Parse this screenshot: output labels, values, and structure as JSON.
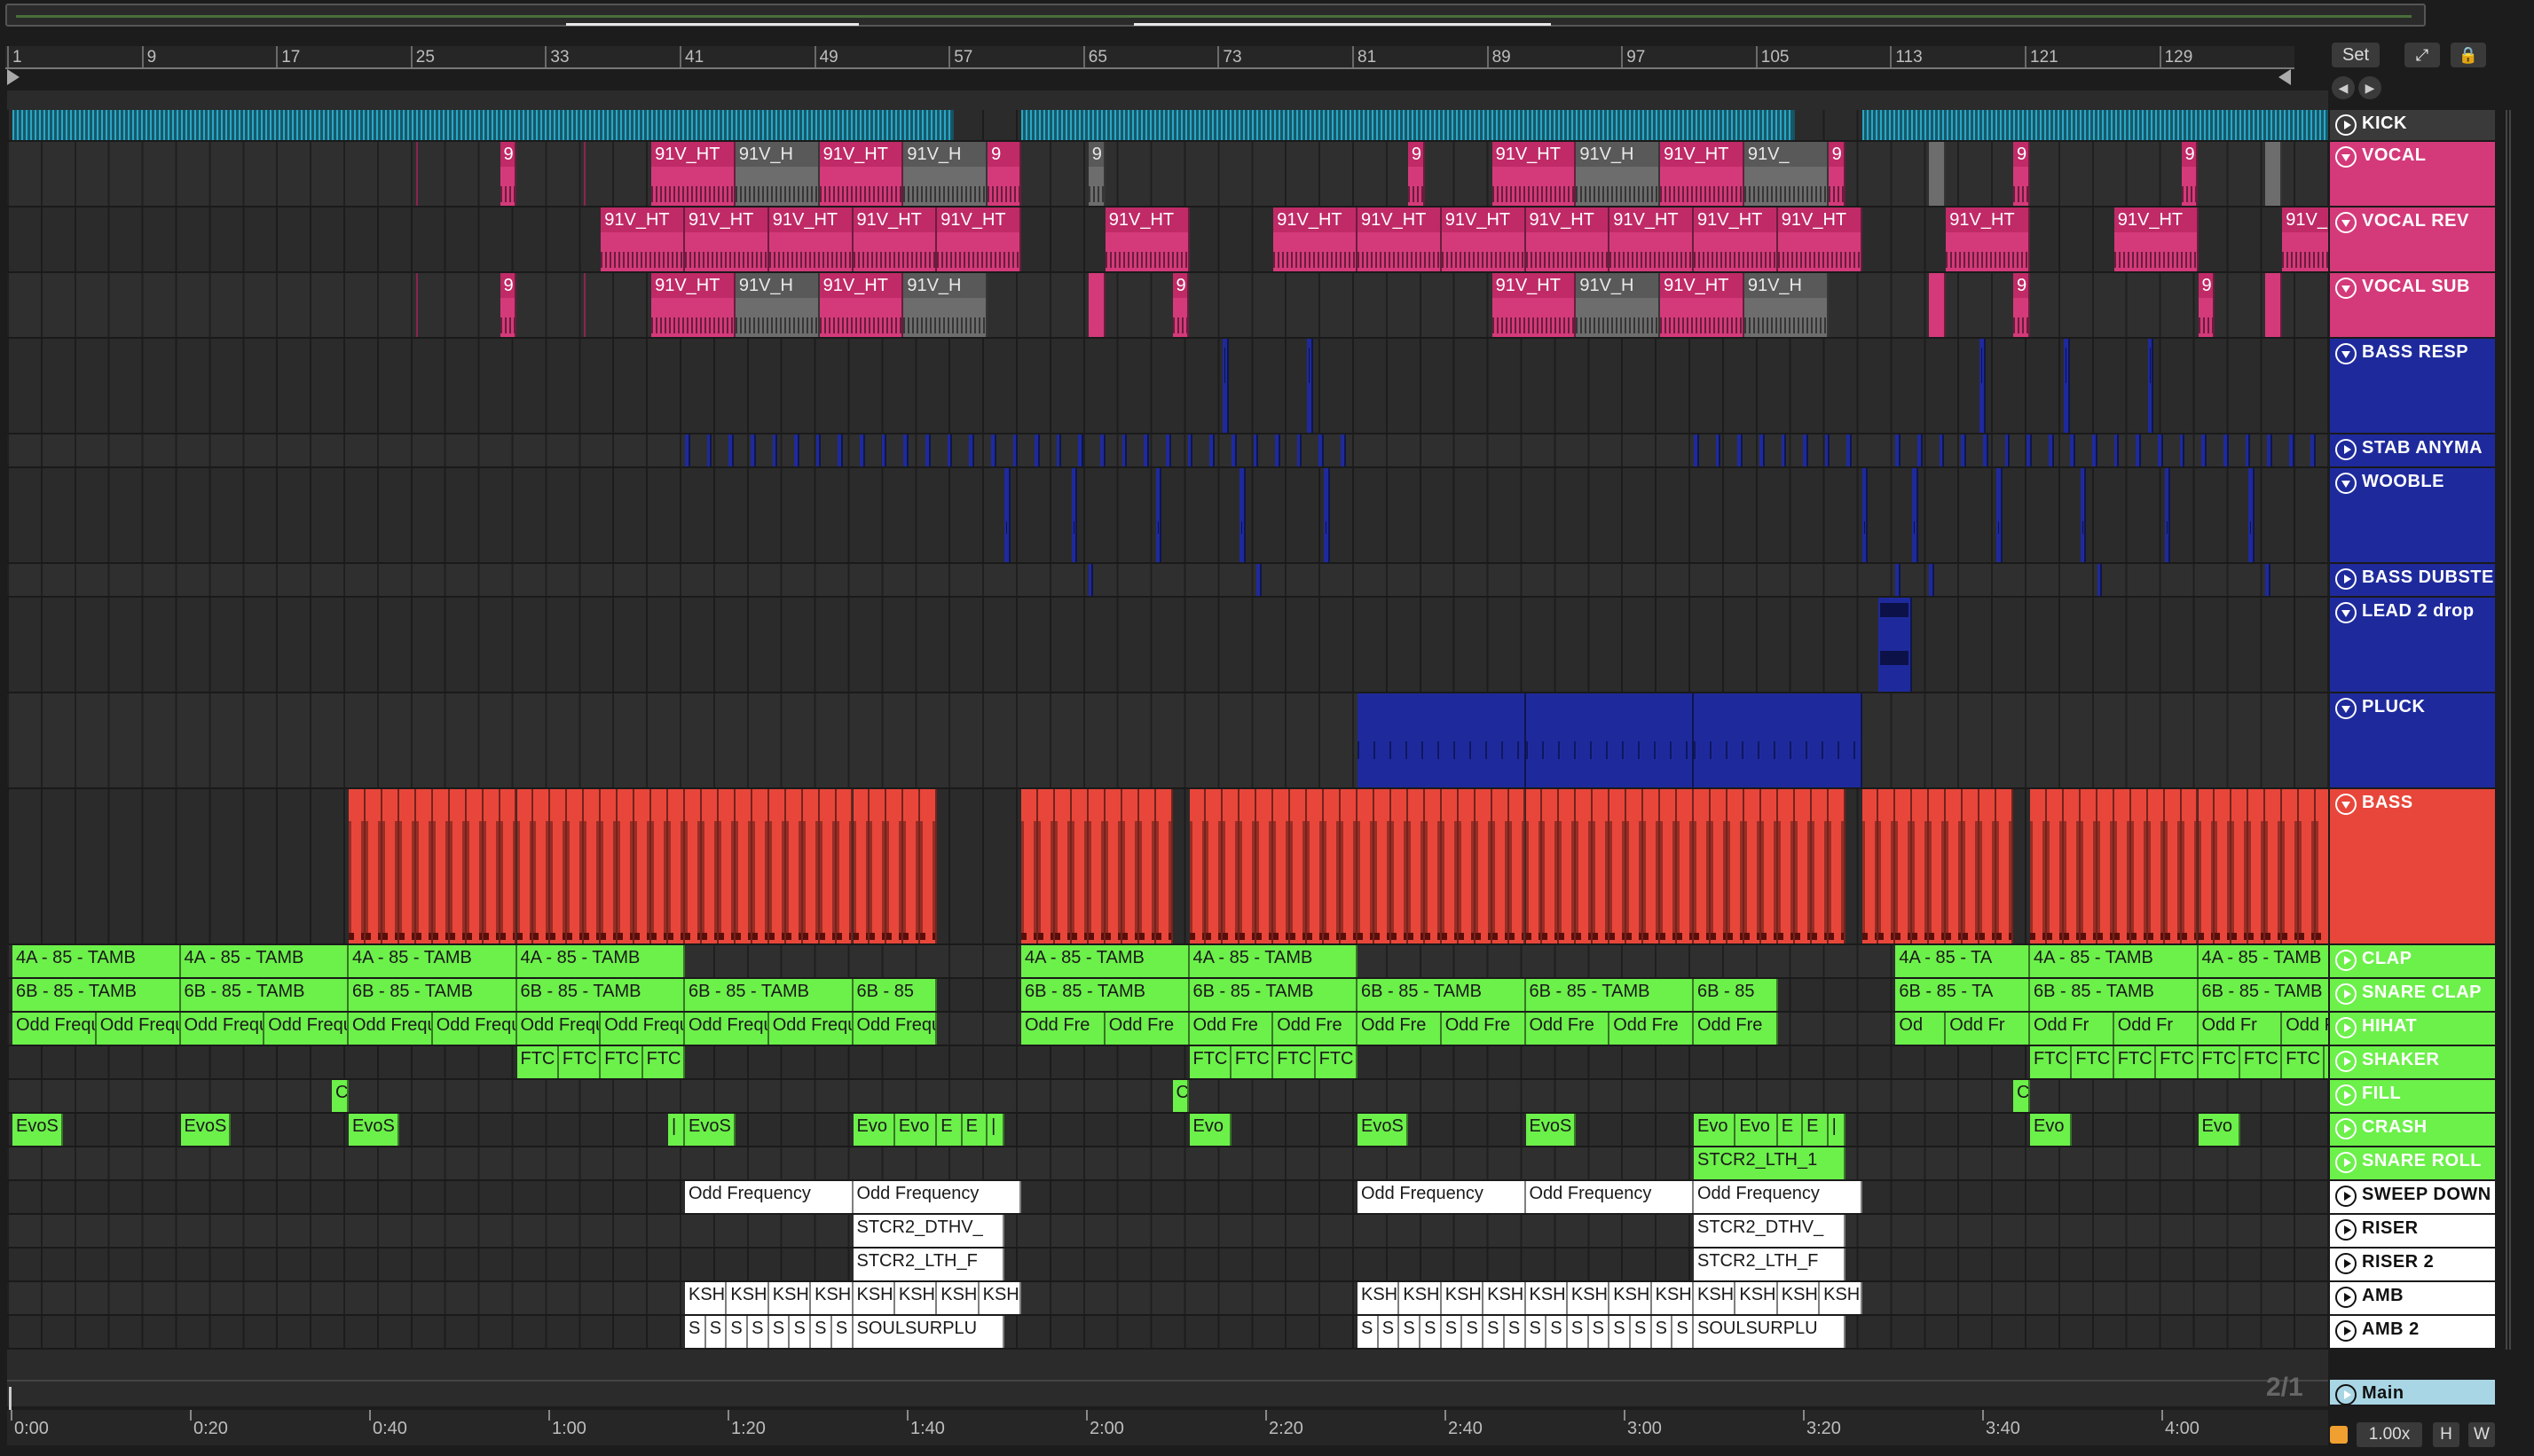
{
  "bar_numbers": [
    "1",
    "9",
    "17",
    "25",
    "33",
    "41",
    "49",
    "57",
    "65",
    "73",
    "81",
    "89",
    "97",
    "105",
    "113",
    "121",
    "129"
  ],
  "time_labels": [
    "0:00",
    "0:20",
    "0:40",
    "1:00",
    "1:20",
    "1:40",
    "2:00",
    "2:20",
    "2:40",
    "3:00",
    "3:20",
    "3:40",
    "4:00"
  ],
  "controls": {
    "set_label": "Set",
    "expand_icon": "⤢",
    "lock_icon": "🔒",
    "prev_icon": "◀",
    "next_icon": "▶"
  },
  "page_indicator": "2/1",
  "zoom": {
    "value": "1.00x",
    "h_label": "H",
    "w_label": "W"
  },
  "colors": {
    "pink": "#d43a7a",
    "navy": "#1e2a9c",
    "red": "#e8463a",
    "green": "#6cf04a",
    "white": "#ffffff",
    "main": "#a9d6e5"
  },
  "tracks": [
    {
      "name": "KICK",
      "color": "#3a3a3a",
      "icon": "play-icon"
    },
    {
      "name": "VOCAL",
      "color": "#d43a7a",
      "icon": "fold-icon"
    },
    {
      "name": "VOCAL REV",
      "color": "#d43a7a",
      "icon": "fold-icon"
    },
    {
      "name": "VOCAL SUB",
      "color": "#d43a7a",
      "icon": "fold-icon"
    },
    {
      "name": "BASS RESP",
      "color": "#1e2a9c",
      "icon": "fold-icon"
    },
    {
      "name": "STAB ANYMA",
      "color": "#1e2a9c",
      "icon": "play-icon"
    },
    {
      "name": "WOOBLE",
      "color": "#1e2a9c",
      "icon": "fold-icon"
    },
    {
      "name": "BASS DUBSTE",
      "color": "#1e2a9c",
      "icon": "play-icon"
    },
    {
      "name": "LEAD 2 drop",
      "color": "#1e2a9c",
      "icon": "fold-icon"
    },
    {
      "name": "PLUCK",
      "color": "#1e2a9c",
      "icon": "fold-icon"
    },
    {
      "name": "BASS",
      "color": "#e8463a",
      "icon": "fold-icon"
    },
    {
      "name": "CLAP",
      "color": "#6cf04a",
      "icon": "play-icon"
    },
    {
      "name": "SNARE CLAP",
      "color": "#6cf04a",
      "icon": "play-icon"
    },
    {
      "name": "HIHAT",
      "color": "#6cf04a",
      "icon": "play-icon"
    },
    {
      "name": "SHAKER",
      "color": "#6cf04a",
      "icon": "play-icon"
    },
    {
      "name": "FILL",
      "color": "#6cf04a",
      "icon": "play-icon"
    },
    {
      "name": "CRASH",
      "color": "#6cf04a",
      "icon": "play-icon"
    },
    {
      "name": "SNARE ROLL",
      "color": "#6cf04a",
      "icon": "play-icon"
    },
    {
      "name": "SWEEP DOWN",
      "color": "#ffffff",
      "icon": "play-icon"
    },
    {
      "name": "RISER",
      "color": "#ffffff",
      "icon": "play-icon"
    },
    {
      "name": "RISER 2",
      "color": "#ffffff",
      "icon": "play-icon"
    },
    {
      "name": "AMB",
      "color": "#ffffff",
      "icon": "play-icon"
    },
    {
      "name": "AMB 2",
      "color": "#ffffff",
      "icon": "play-icon"
    }
  ],
  "master": {
    "name": "Main",
    "color": "#a9d6e5"
  },
  "clip_names": {
    "vocal": "91V_HT",
    "vocal_short": "9",
    "vocal_cut": "91V_H",
    "vocal_grey": "91V_H",
    "clap": "4A - 85 - TAMB",
    "clap_cut": "4A - 85 - TA",
    "snare": "6B - 85 - TAMB",
    "snare_cut": "6B - 85 - TA",
    "snare_short": "6B - 85",
    "hihat": "Odd Frequ",
    "hihat_short": "Odd Fre",
    "hihat_cut": "Odd Fr",
    "hihat_tiny": "Od",
    "shaker": "FTC",
    "fill": "C",
    "crash": "EvoS",
    "crash_short": "Evo",
    "crash_e": "E",
    "crash_bar": "|",
    "snareroll": "STCR2_LTH_1",
    "sweep": "Odd Frequency",
    "riser": "STCR2_DTHV_",
    "riser2": "STCR2_LTH_F",
    "amb": "KSH",
    "amb2": "S",
    "amb2_long": "SOULSURPLU"
  }
}
